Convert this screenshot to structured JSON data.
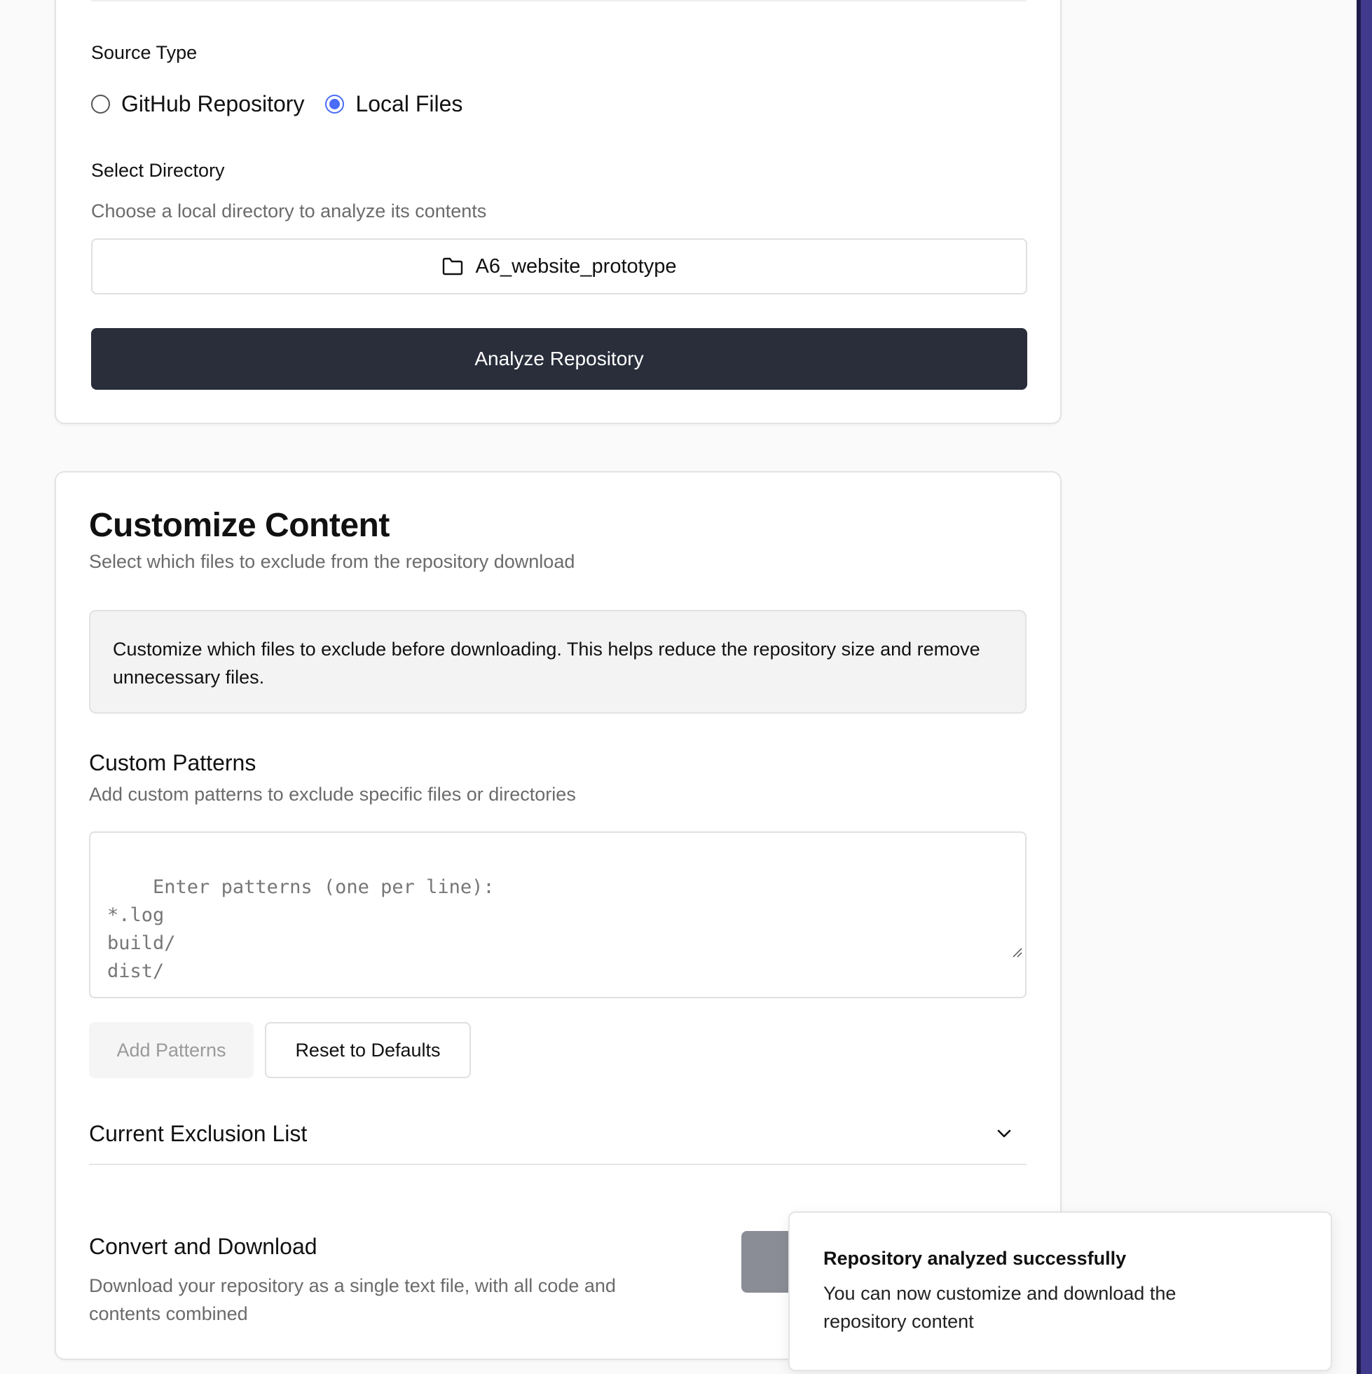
{
  "source": {
    "label": "Source Type",
    "options": [
      {
        "label": "GitHub Repository",
        "selected": false
      },
      {
        "label": "Local Files",
        "selected": true
      }
    ]
  },
  "directory": {
    "label": "Select Directory",
    "hint": "Choose a local directory to analyze its contents",
    "selected": "A6_website_prototype",
    "icon": "folder-icon"
  },
  "analyze_button": "Analyze Repository",
  "customize": {
    "title": "Customize Content",
    "subtitle": "Select which files to exclude from the repository download",
    "info": "Customize which files to exclude before downloading. This helps reduce the repository size and remove unnecessary files.",
    "custom_patterns_title": "Custom Patterns",
    "custom_patterns_hint": "Add custom patterns to exclude specific files or directories",
    "patterns_placeholder": "Enter patterns (one per line):\n*.log\nbuild/\ndist/",
    "add_patterns": "Add Patterns",
    "reset_defaults": "Reset to Defaults",
    "exclusion_list": "Current Exclusion List",
    "convert_title": "Convert and Download",
    "convert_hint": "Download your repository as a single text file, with all code and contents combined"
  },
  "toast": {
    "title": "Repository analyzed successfully",
    "body": "You can now customize and download the repository content"
  },
  "colors": {
    "accent": "#4a6cf7",
    "primary_button": "#2a2e3b"
  }
}
